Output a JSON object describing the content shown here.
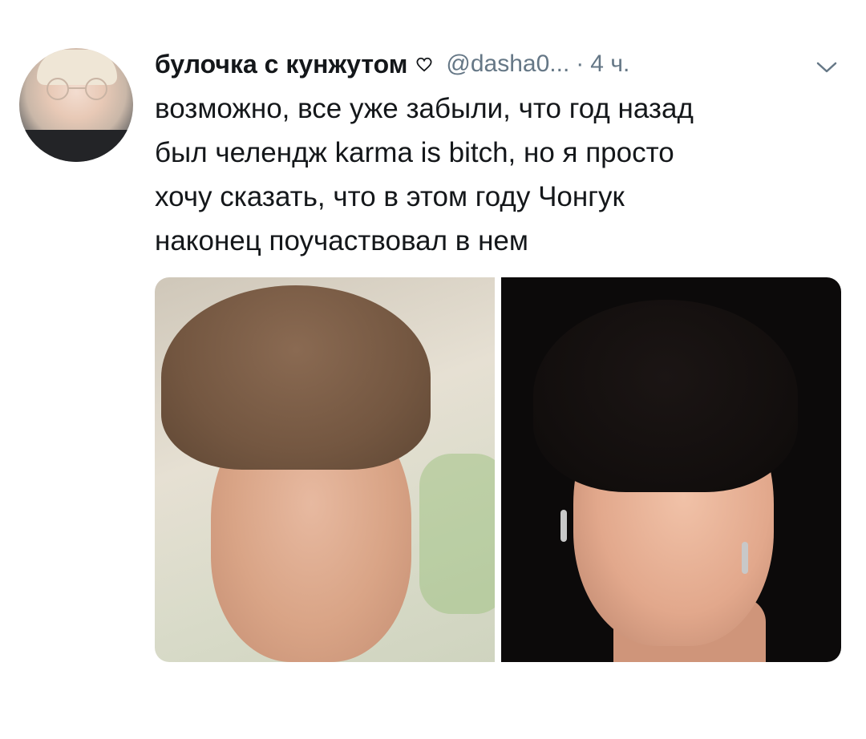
{
  "tweet": {
    "display_name": "булочка с кунжутом",
    "handle": "@dasha0...",
    "separator": "·",
    "time": "4 ч.",
    "text": "возможно, все уже забыли, что год назад\nбыл челендж karma is bitch, но я просто\nхочу сказать, что в этом году Чонгук\nнаконец поучаствовал в нем"
  },
  "icons": {
    "heart": "heart-outline-icon",
    "menu": "chevron-down-icon"
  },
  "colors": {
    "text_primary": "#14171a",
    "text_secondary": "#657786",
    "background": "#ffffff"
  }
}
